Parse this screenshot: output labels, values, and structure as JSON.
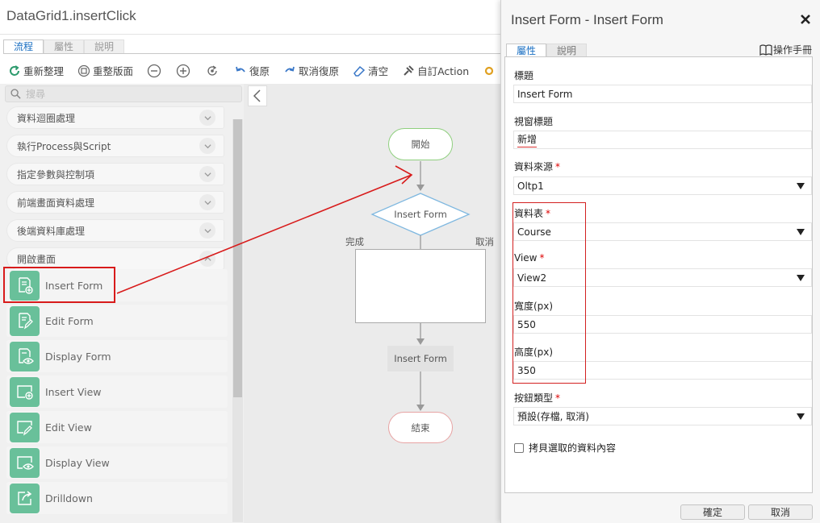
{
  "window": {
    "title": "DataGrid1.insertClick"
  },
  "tabs": [
    {
      "label": "流程",
      "active": true
    },
    {
      "label": "屬性",
      "active": false
    },
    {
      "label": "說明",
      "active": false
    }
  ],
  "toolbar": {
    "refresh": "重新整理",
    "relayout": "重整版面",
    "undo": "復原",
    "redo": "取消復原",
    "clear": "清空",
    "custom_action": "自訂Action"
  },
  "palette": {
    "search_placeholder": "搜尋",
    "categories": [
      "資料迴圈處理",
      "執行Process與Script",
      "指定參數與控制項",
      "前端畫面資料處理",
      "後端資料庫處理",
      "開啟畫面"
    ],
    "items": [
      {
        "label": "Insert Form",
        "icon": "form-add-icon"
      },
      {
        "label": "Edit Form",
        "icon": "form-edit-icon"
      },
      {
        "label": "Display Form",
        "icon": "form-view-icon"
      },
      {
        "label": "Insert View",
        "icon": "view-add-icon"
      },
      {
        "label": "Edit View",
        "icon": "view-edit-icon"
      },
      {
        "label": "Display View",
        "icon": "view-display-icon"
      },
      {
        "label": "Drilldown",
        "icon": "drilldown-icon"
      }
    ],
    "accent_color": "#69c09a"
  },
  "flow": {
    "start": "開始",
    "decision": "Insert Form",
    "branch_done": "完成",
    "branch_cancel": "取消",
    "action": "Insert Form",
    "end": "結束"
  },
  "dialog": {
    "title": "Insert Form - Insert Form",
    "tabs": [
      {
        "label": "屬性",
        "active": true
      },
      {
        "label": "說明",
        "active": false
      }
    ],
    "manual": "操作手冊",
    "fields": {
      "title_label": "標題",
      "title_value": "Insert Form",
      "window_title_label": "視窗標題",
      "window_title_value": "新增",
      "datasource_label": "資料來源",
      "datasource_value": "Oltp1",
      "table_label": "資料表",
      "table_value": "Course",
      "view_label": "View",
      "view_value": "View2",
      "width_label": "寬度(px)",
      "width_value": "550",
      "height_label": "高度(px)",
      "height_value": "350",
      "button_type_label": "按鈕類型",
      "button_type_value": "預設(存檔, 取消)"
    },
    "copy_checkbox": "拷貝選取的資料內容",
    "ok": "確定",
    "cancel": "取消"
  },
  "colors": {
    "highlight": "#d81b1b",
    "tab_active": "#1a6fc2",
    "start_node": "#8fcf7e",
    "end_node": "#e7a3a3",
    "decision_node": "#7fb8e0"
  }
}
